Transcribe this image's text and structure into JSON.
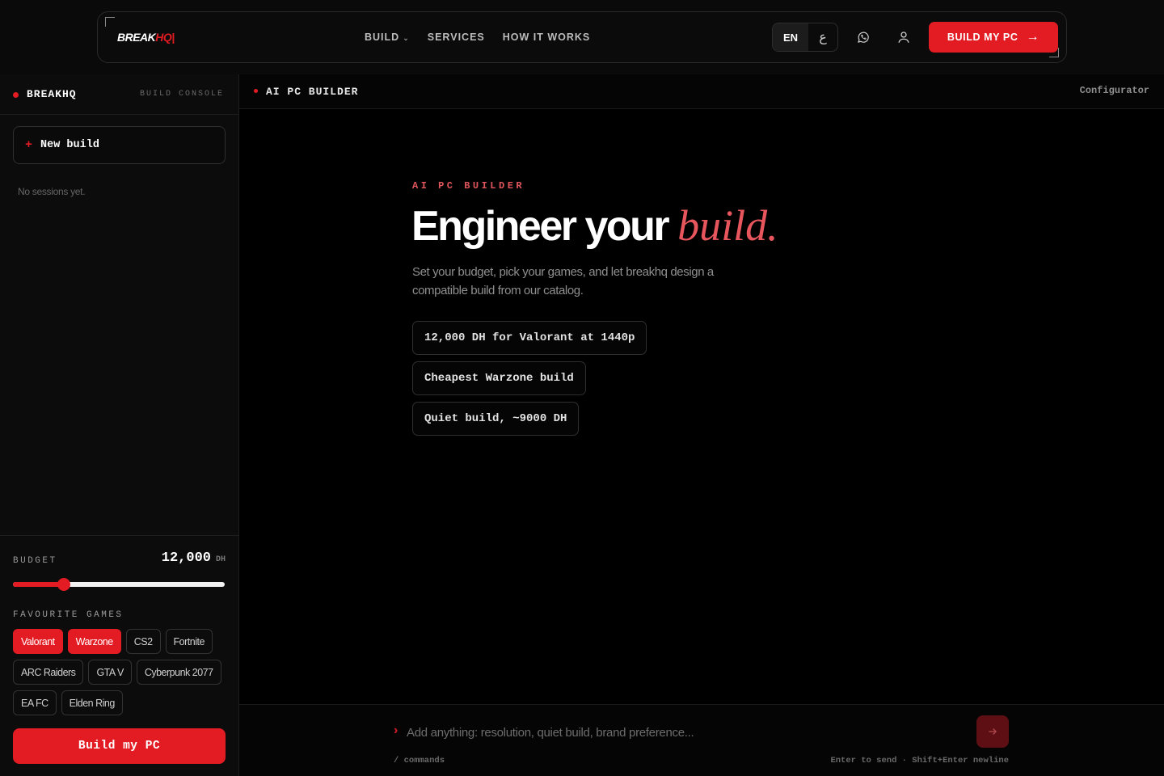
{
  "header": {
    "logo_main": "BREAK",
    "logo_accent": "HQ",
    "nav": [
      "BUILD",
      "SERVICES",
      "HOW IT WORKS"
    ],
    "lang_en": "EN",
    "lang_ar": "ع",
    "cta_label": "BUILD MY PC",
    "cta_arrow": "→"
  },
  "sidebar": {
    "brand": "BREAKHQ",
    "console_label": "BUILD CONSOLE",
    "new_build_plus": "+",
    "new_build_label": "New build",
    "no_sessions": "No sessions yet.",
    "budget_label": "BUDGET",
    "budget_value": "12,000",
    "budget_unit": "DH",
    "budget_level_fraction": 0.24,
    "favourite_label": "FAVOURITE GAMES",
    "games": [
      {
        "label": "Valorant",
        "selected": true
      },
      {
        "label": "Warzone",
        "selected": true
      },
      {
        "label": "CS2",
        "selected": false
      },
      {
        "label": "Fortnite",
        "selected": false
      },
      {
        "label": "ARC Raiders",
        "selected": false
      },
      {
        "label": "GTA V",
        "selected": false
      },
      {
        "label": "Cyberpunk 2077",
        "selected": false
      },
      {
        "label": "EA FC",
        "selected": false
      },
      {
        "label": "Elden Ring",
        "selected": false
      }
    ],
    "build_button": "Build my PC"
  },
  "main": {
    "title": "AI PC BUILDER",
    "right_label": "Configurator",
    "eyebrow": "AI PC BUILDER",
    "hero_text": "Engineer your ",
    "hero_accent": "build.",
    "subtitle": "Set your budget, pick your games, and let breakhq design a compatible build from our catalog.",
    "suggestions": [
      "12,000 DH for Valorant at 1440p",
      "Cheapest Warzone build",
      "Quiet build, ~9000 DH"
    ]
  },
  "composer": {
    "caret": "›",
    "placeholder": "Add anything: resolution, quiet build, brand preference...",
    "commands": "/ commands",
    "hint": "Enter to send · Shift+Enter newline"
  },
  "colors": {
    "accent": "#e31b23",
    "accent_soft": "#e8565d",
    "background": "#000000"
  }
}
